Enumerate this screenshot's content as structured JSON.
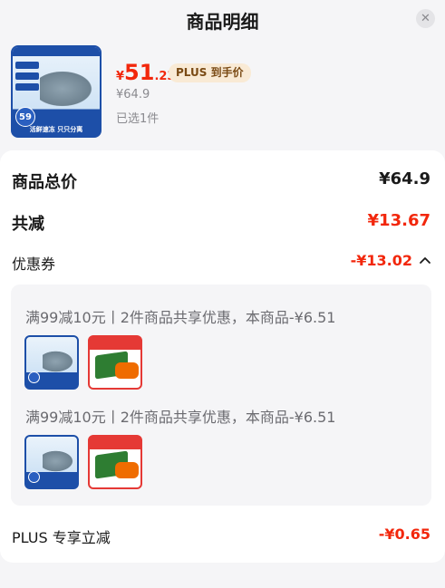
{
  "header": {
    "title": "商品明细",
    "close_label": "✕"
  },
  "product": {
    "price_symbol": "¥",
    "price_integer": "51",
    "price_decimal": ".23",
    "plus_badge": "PLUS 到手价",
    "original_price": "¥64.9",
    "selected_text": "已选1件",
    "thumbnail_badge": "59",
    "thumbnail_caption": "活鲜速冻 只只分离"
  },
  "summary": {
    "total_label": "商品总价",
    "total_value": "¥64.9",
    "reduce_label": "共减",
    "reduce_value": "¥13.67",
    "coupon_label": "优惠券",
    "coupon_value": "-¥13.02",
    "plus_label": "PLUS 专享立减",
    "plus_value": "-¥0.65"
  },
  "coupons": [
    {
      "text": "满99减10元丨2件商品共享优惠，本商品-¥6.51"
    },
    {
      "text": "满99减10元丨2件商品共享优惠，本商品-¥6.51"
    }
  ],
  "colors": {
    "accent": "#f2270c",
    "plus_bg": "#f9ead5",
    "brand_blue": "#1d4fa8"
  }
}
